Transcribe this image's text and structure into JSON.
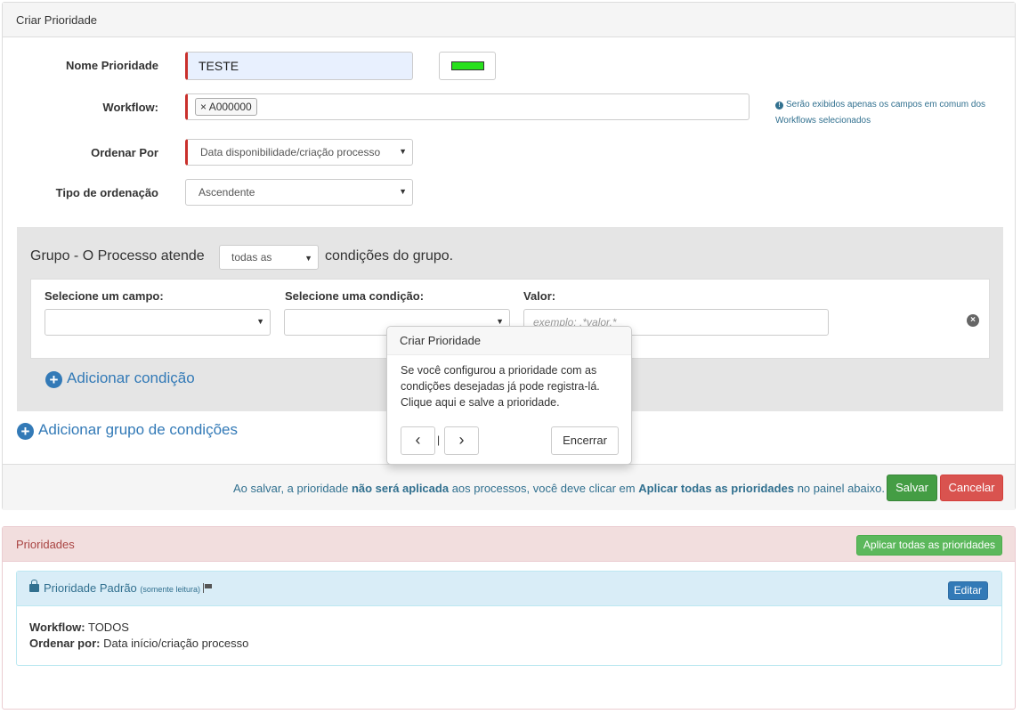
{
  "form_panel": {
    "title": "Criar Prioridade",
    "name_label": "Nome Prioridade",
    "name_value": "TESTE",
    "color": "#28e01c",
    "workflow_label": "Workflow:",
    "workflow_tag_remove": "×",
    "workflow_tag": "A000000",
    "workflow_hint": "Serão exibidos apenas os campos em comum dos Workflows selecionados",
    "order_by_label": "Ordenar Por",
    "order_by_value": "Data disponibilidade/criação processo",
    "order_type_label": "Tipo de ordenação",
    "order_type_value": "Ascendente"
  },
  "group": {
    "title_before": "Grupo - O Processo atende",
    "match_value": "todas as",
    "title_after": "condições do grupo.",
    "field_label": "Selecione um campo:",
    "condition_label": "Selecione uma condição:",
    "value_label": "Valor:",
    "value_placeholder": "exemplo: .*valor.*",
    "add_condition": "Adicionar condição"
  },
  "add_group": "Adicionar grupo de condições",
  "footer": {
    "note_1": "Ao salvar, a prioridade ",
    "note_2": "não será aplicada",
    "note_3": " aos processos, você deve clicar em ",
    "note_4": "Aplicar todas as prioridades",
    "note_5": " no painel abaixo.",
    "save": "Salvar",
    "cancel": "Cancelar"
  },
  "popover": {
    "title": "Criar Prioridade",
    "body": "Se você configurou a prioridade com as condições desejadas já pode registra-lá. Clique aqui e salve a prioridade.",
    "prev": "‹",
    "separator": "|",
    "next": "›",
    "end": "Encerrar"
  },
  "priorities_panel": {
    "title": "Prioridades",
    "apply_all": "Aplicar todas as prioridades",
    "default_title": "Prioridade Padrão",
    "readonly": "(somente leitura)",
    "edit": "Editar",
    "workflow_label": "Workflow:",
    "workflow_value": "TODOS",
    "order_label": "Ordenar por:",
    "order_value": "Data início/criação processo"
  }
}
